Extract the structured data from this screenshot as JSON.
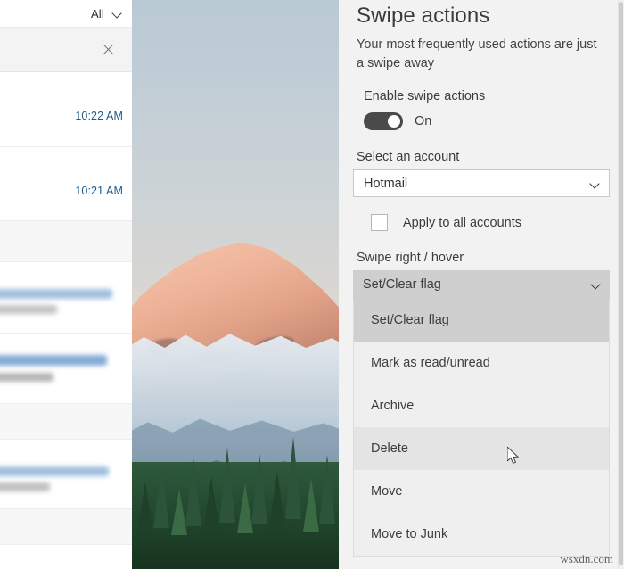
{
  "mail_list": {
    "filter_label": "All",
    "filter_chevron_icon": "chevron-down-icon",
    "clear_search_icon": "close-icon",
    "rows": [
      {
        "time": "10:22 AM"
      },
      {
        "time": "10:21 AM"
      },
      {
        "time": ""
      },
      {
        "time": ""
      },
      {
        "time": ""
      },
      {
        "time": ""
      }
    ]
  },
  "photo": {
    "alt": "mountain-sunset-photo"
  },
  "settings": {
    "title": "Swipe actions",
    "subtitle": "Your most frequently used actions are just a swipe away",
    "enable_label": "Enable swipe actions",
    "toggle_state": "On",
    "toggle_on": true,
    "account_label": "Select an account",
    "account_value": "Hotmail",
    "account_chevron_icon": "chevron-down-icon",
    "apply_all_label": "Apply to all accounts",
    "apply_all_checked": false,
    "swipe_right_label": "Swipe right / hover",
    "swipe_right_value": "Set/Clear flag",
    "swipe_right_chevron_icon": "chevron-down-icon",
    "options": [
      {
        "label": "Set/Clear flag",
        "state": "selected"
      },
      {
        "label": "Mark as read/unread",
        "state": "normal"
      },
      {
        "label": "Archive",
        "state": "normal"
      },
      {
        "label": "Delete",
        "state": "hovered"
      },
      {
        "label": "Move",
        "state": "normal"
      },
      {
        "label": "Move to Junk",
        "state": "normal"
      }
    ]
  },
  "colors": {
    "pane_bg": "#f2f2f2",
    "combo_selected": "#cfcfcf",
    "combo_hover": "#e4e4e4",
    "toggle_on": "#4a4a4a",
    "time_text": "#1f5a8a"
  },
  "watermark": "wsxdn.com"
}
